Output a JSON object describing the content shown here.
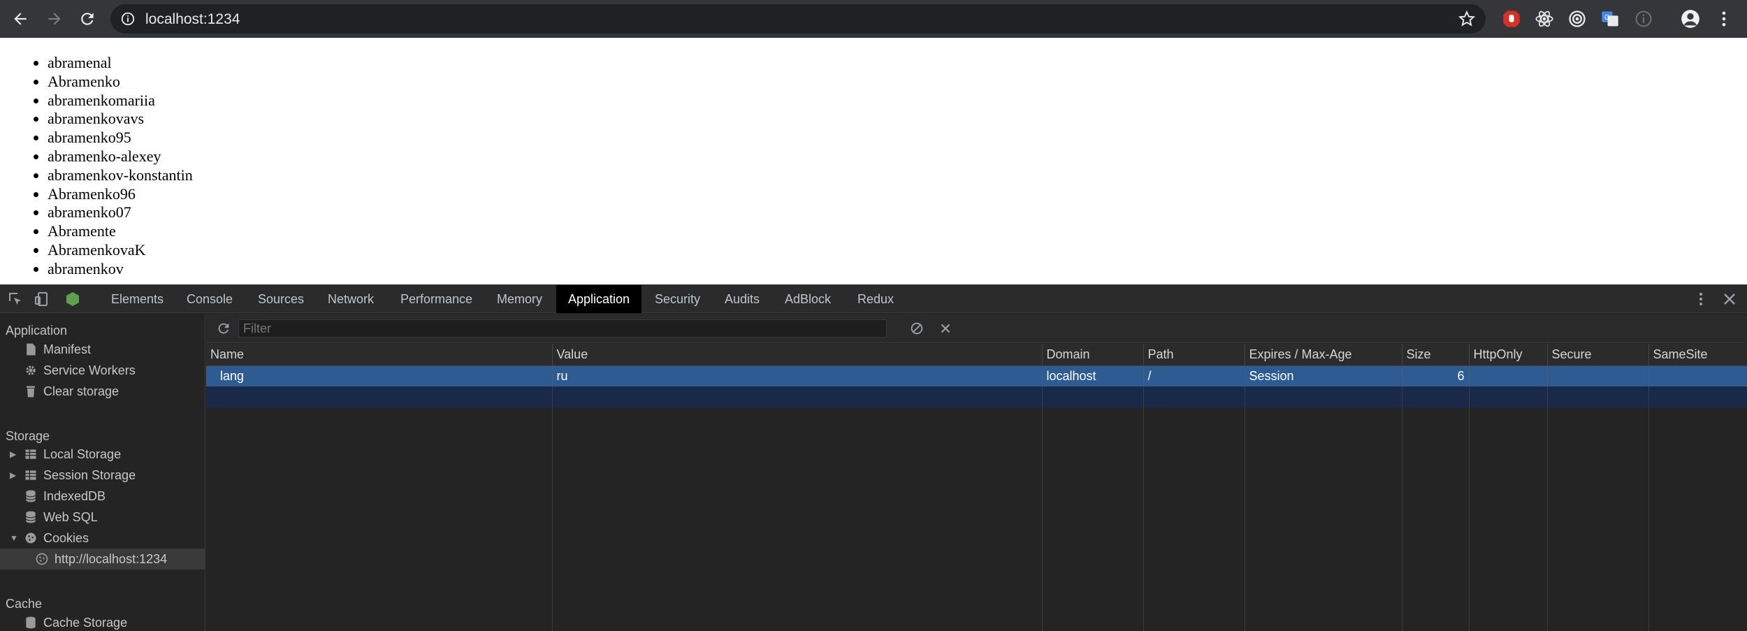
{
  "browser": {
    "url": "localhost:1234"
  },
  "page": {
    "list_items": [
      "abramenal",
      "Abramenko",
      "abramenkomariia",
      "abramenkovavs",
      "abramenko95",
      "abramenko-alexey",
      "abramenkov-konstantin",
      "Abramenko96",
      "abramenko07",
      "Abramente",
      "AbramenkovaK",
      "abramenkov"
    ]
  },
  "devtools": {
    "tabs": [
      "Elements",
      "Console",
      "Sources",
      "Network",
      "Performance",
      "Memory",
      "Application",
      "Security",
      "Audits",
      "AdBlock",
      "Redux"
    ],
    "active_tab": "Application",
    "sidebar": {
      "application_header": "Application",
      "application_items": [
        "Manifest",
        "Service Workers",
        "Clear storage"
      ],
      "storage_header": "Storage",
      "storage_items": [
        "Local Storage",
        "Session Storage",
        "IndexedDB",
        "Web SQL",
        "Cookies"
      ],
      "cookie_origin": "http://localhost:1234",
      "cache_header": "Cache",
      "cache_items": [
        "Cache Storage"
      ]
    },
    "filter_placeholder": "Filter",
    "columns": [
      "Name",
      "Value",
      "Domain",
      "Path",
      "Expires / Max-Age",
      "Size",
      "HttpOnly",
      "Secure",
      "SameSite"
    ],
    "rows": [
      [
        "lang",
        "ru",
        "localhost",
        "/",
        "Session",
        "6",
        "",
        "",
        ""
      ]
    ]
  },
  "colors": {
    "selected_row": "#2d5b92",
    "active_tab_bg": "#000000",
    "toolbar_bg": "#35363a"
  }
}
